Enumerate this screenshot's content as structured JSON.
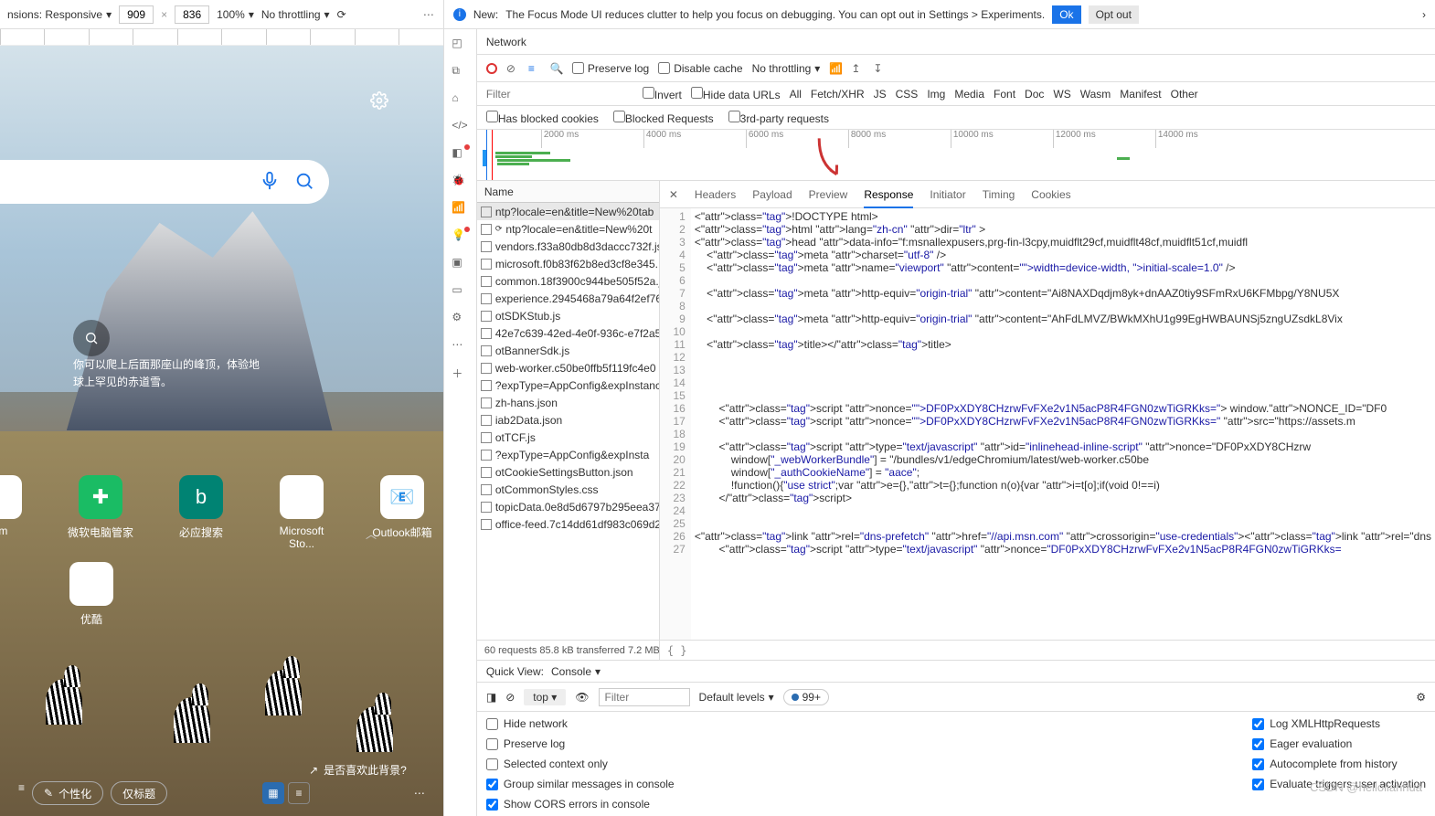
{
  "device": {
    "label": "nsions: Responsive",
    "width": "909",
    "height": "836",
    "zoom": "100%",
    "throttle": "No throttling"
  },
  "ntp": {
    "caption": "你可以爬上后面那座山的峰顶，体验地球上罕见的赤道雪。",
    "tiles": [
      "om",
      "微软电脑管家",
      "必应搜索",
      "Microsoft Sto...",
      "Outlook邮箱",
      "优酷"
    ],
    "bg_like": "是否喜欢此背景?",
    "personalize": "个性化",
    "tab_btn": "仅标题"
  },
  "notice": {
    "prefix": "New:",
    "text": "The Focus Mode UI reduces clutter to help you focus on debugging. You can opt out in Settings > Experiments.",
    "ok": "Ok",
    "optout": "Opt out"
  },
  "tabs": {
    "network": "Network"
  },
  "toolbar": {
    "preserve": "Preserve log",
    "disable": "Disable cache",
    "throttle": "No throttling"
  },
  "filter": {
    "placeholder": "Filter",
    "invert": "Invert",
    "hide": "Hide data URLs",
    "types": [
      "All",
      "Fetch/XHR",
      "JS",
      "CSS",
      "Img",
      "Media",
      "Font",
      "Doc",
      "WS",
      "Wasm",
      "Manifest",
      "Other"
    ]
  },
  "extra": {
    "blocked": "Has blocked cookies",
    "requests": "Blocked Requests",
    "third": "3rd-party requests"
  },
  "timeline_ticks": [
    "2000 ms",
    "4000 ms",
    "6000 ms",
    "8000 ms",
    "10000 ms",
    "12000 ms",
    "14000 ms"
  ],
  "requests_header": "Name",
  "requests": [
    "ntp?locale=en&title=New%20tab",
    "ntp?locale=en&title=New%20t",
    "vendors.f33a80db8d3daccc732f.js",
    "microsoft.f0b83f62b8ed3cf8e345.",
    "common.18f3900c944be505f52a.j",
    "experience.2945468a79a64f2ef76.",
    "otSDKStub.js",
    "42e7c639-42ed-4e0f-936c-e7f2a5",
    "otBannerSdk.js",
    "web-worker.c50be0ffb5f119fc4e0",
    "?expType=AppConfig&expInstanc",
    "zh-hans.json",
    "iab2Data.json",
    "otTCF.js",
    "?expType=AppConfig&expInsta",
    "otCookieSettingsButton.json",
    "otCommonStyles.css",
    "topicData.0e8d5d6797b295eea37",
    "office-feed.7c14dd61df983c069d2"
  ],
  "status_bar": "60 requests   85.8 kB transferred   7.2 MB",
  "detail_tabs": [
    "Headers",
    "Payload",
    "Preview",
    "Response",
    "Initiator",
    "Timing",
    "Cookies"
  ],
  "code_lines": [
    "<!DOCTYPE html>",
    "<html lang=\"zh-cn\" dir=\"ltr\" >",
    "<head data-info=\"f:msnallexpusers,prg-fin-l3cpy,muidflt29cf,muidflt48cf,muidflt51cf,muidfl",
    "    <meta charset=\"utf-8\" />",
    "    <meta name=\"viewport\" content=\"width=device-width, initial-scale=1.0\" />",
    "",
    "    <meta http-equiv=\"origin-trial\" content=\"Ai8NAXDqdjm8yk+dnAAZ0tiy9SFmRxU6KFMbpg/Y8NU5X",
    "",
    "    <meta http-equiv=\"origin-trial\" content=\"AhFdLMVZ/BWkMXhU1g99EgHWBAUNSj5zngUZsdkL8Vix",
    "",
    "    <title></title>",
    "",
    "",
    "",
    "",
    "        <script nonce=\"DF0PxXDY8CHzrwFvFXe2v1N5acP8R4FGN0zwTiGRKks=\"> window.NONCE_ID=\"DF0",
    "        <script nonce=\"DF0PxXDY8CHzrwFvFXe2v1N5acP8R4FGN0zwTiGRKks=\" src=\"https://assets.m",
    "",
    "        <script type=\"text/javascript\" id=\"inlinehead-inline-script\" nonce=\"DF0PxXDY8CHzrw",
    "            window[\"_webWorkerBundle\"] = \"/bundles/v1/edgeChromium/latest/web-worker.c50be",
    "            window[\"_authCookieName\"] = \"aace\";",
    "            !function(){\"use strict\";var e={},t={};function n(o){var i=t[o];if(void 0!==i)",
    "        </script>",
    "",
    "",
    "<link rel=\"dns-prefetch\" href=\"//api.msn.com\" crossorigin=\"use-credentials\"><link rel=\"dns",
    "        <script type=\"text/javascript\" nonce=\"DF0PxXDY8CHzrwFvFXe2v1N5acP8R4FGN0zwTiGRKks="
  ],
  "brace": "{ }",
  "quickview": {
    "label": "Quick View:",
    "console": "Console"
  },
  "console": {
    "top": "top",
    "filter_ph": "Filter",
    "levels": "Default levels",
    "issues": "99+",
    "left": [
      "Hide network",
      "Preserve log",
      "Selected context only",
      "Group similar messages in console",
      "Show CORS errors in console"
    ],
    "right": [
      "Log XMLHttpRequests",
      "Eager evaluation",
      "Autocomplete from history",
      "Evaluate triggers user activation"
    ]
  },
  "watermark": "CSDN @hellolianhua"
}
